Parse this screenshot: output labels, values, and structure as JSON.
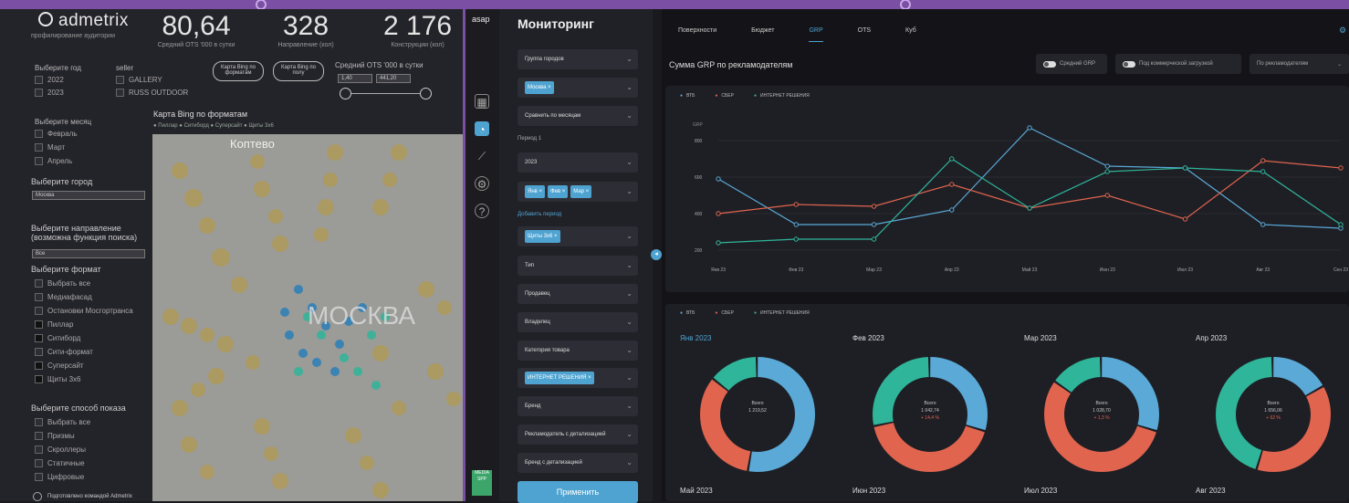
{
  "top_dots": true,
  "left": {
    "logo": "admetrix",
    "logo_sub": "профилирование аудитории",
    "kpis": [
      {
        "value": "80,64",
        "label": "Средний OTS '000 в сутки"
      },
      {
        "value": "328",
        "label": "Направление (кол)"
      },
      {
        "value": "2 176",
        "label": "Конструкции (кол)"
      }
    ],
    "year_label": "Выберите год",
    "years": [
      "2022",
      "2023"
    ],
    "seller_label": "seller",
    "sellers": [
      "GALLERY",
      "RUSS OUTDOOR"
    ],
    "btn_bing_formats": "Карта Bing по форматам",
    "btn_bing_poly": "Карта Bing по полу",
    "ots_label": "Средний OTS '000 в сутки",
    "ots_min": "1,40",
    "ots_max": "441,20",
    "month_label": "Выберите месяц",
    "months": [
      "Февраль",
      "Март",
      "Апрель"
    ],
    "city_label": "Выберите город",
    "city_value": "Москва",
    "direction_label": "Выберите направление (возможна функция поиска)",
    "direction_value": "Все",
    "format_label": "Выберите формат",
    "formats": [
      "Выбрать все",
      "Медиафасад",
      "Остановки Мосгортранса",
      "Пиллар",
      "Ситиборд",
      "Сити-формат",
      "Суперсайт",
      "Щиты 3х6"
    ],
    "method_label": "Выберите способ показа",
    "methods": [
      "Выбрать все",
      "Призмы",
      "Скроллеры",
      "Статичные",
      "Цифровые"
    ],
    "map_title": "Карта Bing по форматам",
    "map_legend": "● Пиллар  ● Ситиборд  ● Суперсайт  ● Щиты 3х6",
    "map_city": "МОСКВА",
    "map_town": "Коптево",
    "footer": "Подготовлено командой Admetrix"
  },
  "filters": {
    "title": "Мониторинг",
    "city_group": "Группа городов",
    "city_chip": "Москва",
    "compare": "Сравнить по месяцам",
    "period_label": "Период 1",
    "year": "2023",
    "month_chips": [
      "Янв",
      "Фев",
      "Мар"
    ],
    "add_period": "Добавить период",
    "format_chip": "Щиты 3х6",
    "fields": [
      "Тип",
      "Продавец",
      "Владелец",
      "Категория товара"
    ],
    "advertiser_chip": "ИНТЕРНЕТ РЕШЕНИЯ",
    "fields2": [
      "Бренд",
      "Рекламодатель с детализацией",
      "Бренд с детализацией"
    ],
    "apply": "Применить"
  },
  "main": {
    "tabs": [
      "Поверхности",
      "Бюджет",
      "GRP",
      "OTS",
      "Куб"
    ],
    "active_tab": "GRP",
    "title": "Сумма GRP по рекламодателям",
    "toggle1": "Средний GRP",
    "toggle2": "Под коммерческой загрузкой",
    "dropdown": "По рекламодателям",
    "legend": [
      "ВТБ",
      "СБЕР",
      "ИНТЕРНЕТ РЕШЕНИЯ"
    ],
    "donuts": [
      {
        "month": "Янв 2023",
        "total_label": "Всего",
        "total": "1 219,52",
        "delta": ""
      },
      {
        "month": "Фев 2023",
        "total_label": "Всего",
        "total": "1 042,74",
        "delta": "+ 14,4 %"
      },
      {
        "month": "Мар 2023",
        "total_label": "Всего",
        "total": "1 028,70",
        "delta": "+ 1,3 %"
      },
      {
        "month": "Апр 2023",
        "total_label": "Всего",
        "total": "1 656,06",
        "delta": "+ 62 %"
      }
    ],
    "bottom_months": [
      "Май 2023",
      "Июн 2023",
      "Июл 2023",
      "Авг 2023"
    ]
  },
  "chart_data": {
    "type": "line",
    "categories": [
      "Янв 23",
      "Фев 23",
      "Мар 23",
      "Апр 23",
      "Май 23",
      "Июн 23",
      "Июл 23",
      "Авг 23",
      "Сен 23"
    ],
    "ylabel": "GRP",
    "yticks": [
      "800",
      "600",
      "400",
      "200"
    ],
    "ylim": [
      150,
      900
    ],
    "series": [
      {
        "name": "ВТБ",
        "color": "#5aa9d6",
        "values": [
          590,
          340,
          340,
          420,
          870,
          660,
          650,
          340,
          320
        ]
      },
      {
        "name": "СБЕР",
        "color": "#e0644e",
        "values": [
          400,
          450,
          440,
          560,
          430,
          500,
          370,
          690,
          650
        ]
      },
      {
        "name": "ИНТЕРНЕТ РЕШЕНИЯ",
        "color": "#2fb59a",
        "values": [
          240,
          260,
          260,
          700,
          430,
          630,
          650,
          630,
          340
        ]
      }
    ],
    "donut_shares": [
      [
        0.53,
        0.33,
        0.14
      ],
      [
        0.3,
        0.42,
        0.28
      ],
      [
        0.3,
        0.55,
        0.15
      ],
      [
        0.17,
        0.38,
        0.45
      ]
    ]
  }
}
